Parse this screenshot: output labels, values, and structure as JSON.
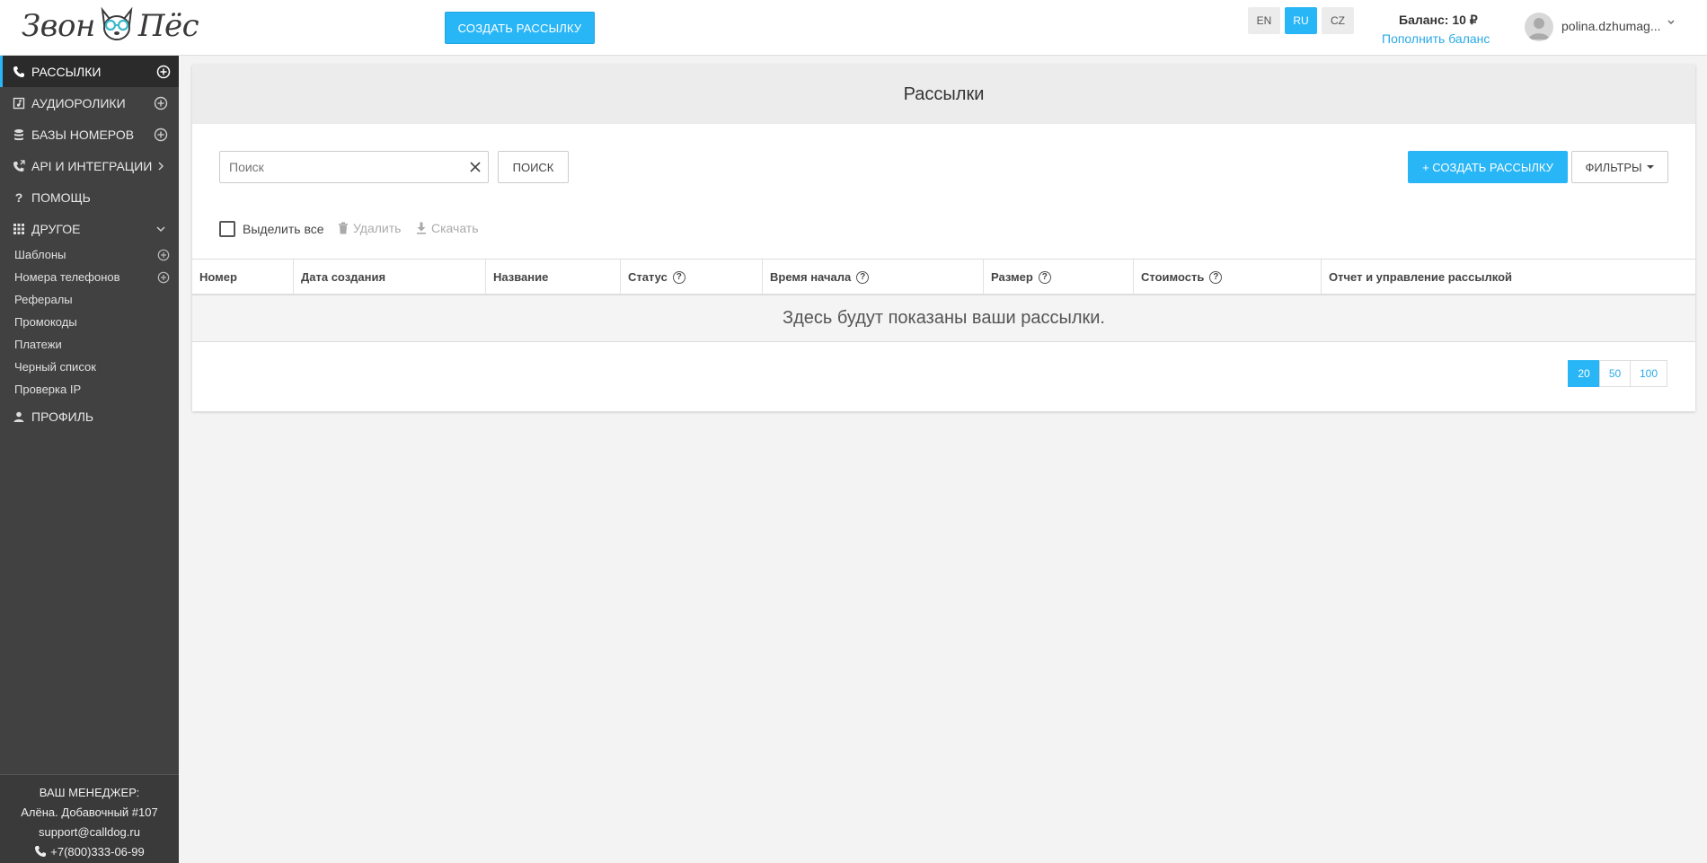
{
  "header": {
    "logo_text_left": "Звон",
    "logo_text_right": "Пёс",
    "create_button": "СОЗДАТЬ РАССЫЛКУ",
    "languages": [
      {
        "code": "EN",
        "active": false
      },
      {
        "code": "RU",
        "active": true
      },
      {
        "code": "CZ",
        "active": false
      }
    ],
    "balance_label": "Баланс: 10 ₽",
    "top_up_link": "Пополнить баланс",
    "username": "polina.dzhumag..."
  },
  "sidebar": {
    "items": [
      {
        "label": "РАССЫЛКИ",
        "icon": "phone-icon",
        "right": "plus-circle-icon",
        "active": true
      },
      {
        "label": "АУДИОРОЛИКИ",
        "icon": "audio-file-icon",
        "right": "plus-circle-icon",
        "active": false
      },
      {
        "label": "БАЗЫ НОМЕРОВ",
        "icon": "database-icon",
        "right": "plus-circle-icon",
        "active": false
      },
      {
        "label": "API И ИНТЕГРАЦИИ",
        "icon": "phone-forward-icon",
        "right": "chevron-right-icon",
        "active": false
      },
      {
        "label": "ПОМОЩЬ",
        "icon": "question-icon",
        "right": "",
        "active": false
      },
      {
        "label": "ДРУГОЕ",
        "icon": "grid-icon",
        "right": "chevron-down-icon",
        "active": false
      }
    ],
    "subitems": [
      {
        "label": "Шаблоны",
        "plus": true
      },
      {
        "label": "Номера телефонов",
        "plus": true
      },
      {
        "label": "Рефералы",
        "plus": false
      },
      {
        "label": "Промокоды",
        "plus": false
      },
      {
        "label": "Платежи",
        "plus": false
      },
      {
        "label": "Черный список",
        "plus": false
      },
      {
        "label": "Проверка IP",
        "plus": false
      }
    ],
    "profile": "ПРОФИЛЬ",
    "manager": {
      "title": "ВАШ МЕНЕДЖЕР:",
      "name": "Алёна. Добавочный #107",
      "email": "support@calldog.ru",
      "phone": "+7(800)333-06-99"
    }
  },
  "main": {
    "title": "Рассылки",
    "search_placeholder": "Поиск",
    "search_button": "ПОИСК",
    "create_button": "+ СОЗДАТЬ РАССЫЛКУ",
    "filters_button": "ФИЛЬТРЫ",
    "select_all": "Выделить все",
    "delete": "Удалить",
    "download": "Скачать",
    "columns": [
      {
        "label": "Номер",
        "help": false
      },
      {
        "label": "Дата создания",
        "help": false
      },
      {
        "label": "Название",
        "help": false
      },
      {
        "label": "Статус",
        "help": true
      },
      {
        "label": "Время начала",
        "help": true
      },
      {
        "label": "Размер",
        "help": true
      },
      {
        "label": "Стоимость",
        "help": true
      },
      {
        "label": "Отчет и управление рассылкой",
        "help": false
      }
    ],
    "empty_message": "Здесь будут показаны ваши рассылки.",
    "page_sizes": [
      {
        "value": "20",
        "active": true
      },
      {
        "value": "50",
        "active": false
      },
      {
        "value": "100",
        "active": false
      }
    ]
  },
  "colors": {
    "accent": "#29b6f6",
    "sidebar_bg": "#414141",
    "link": "#29a9e8"
  }
}
